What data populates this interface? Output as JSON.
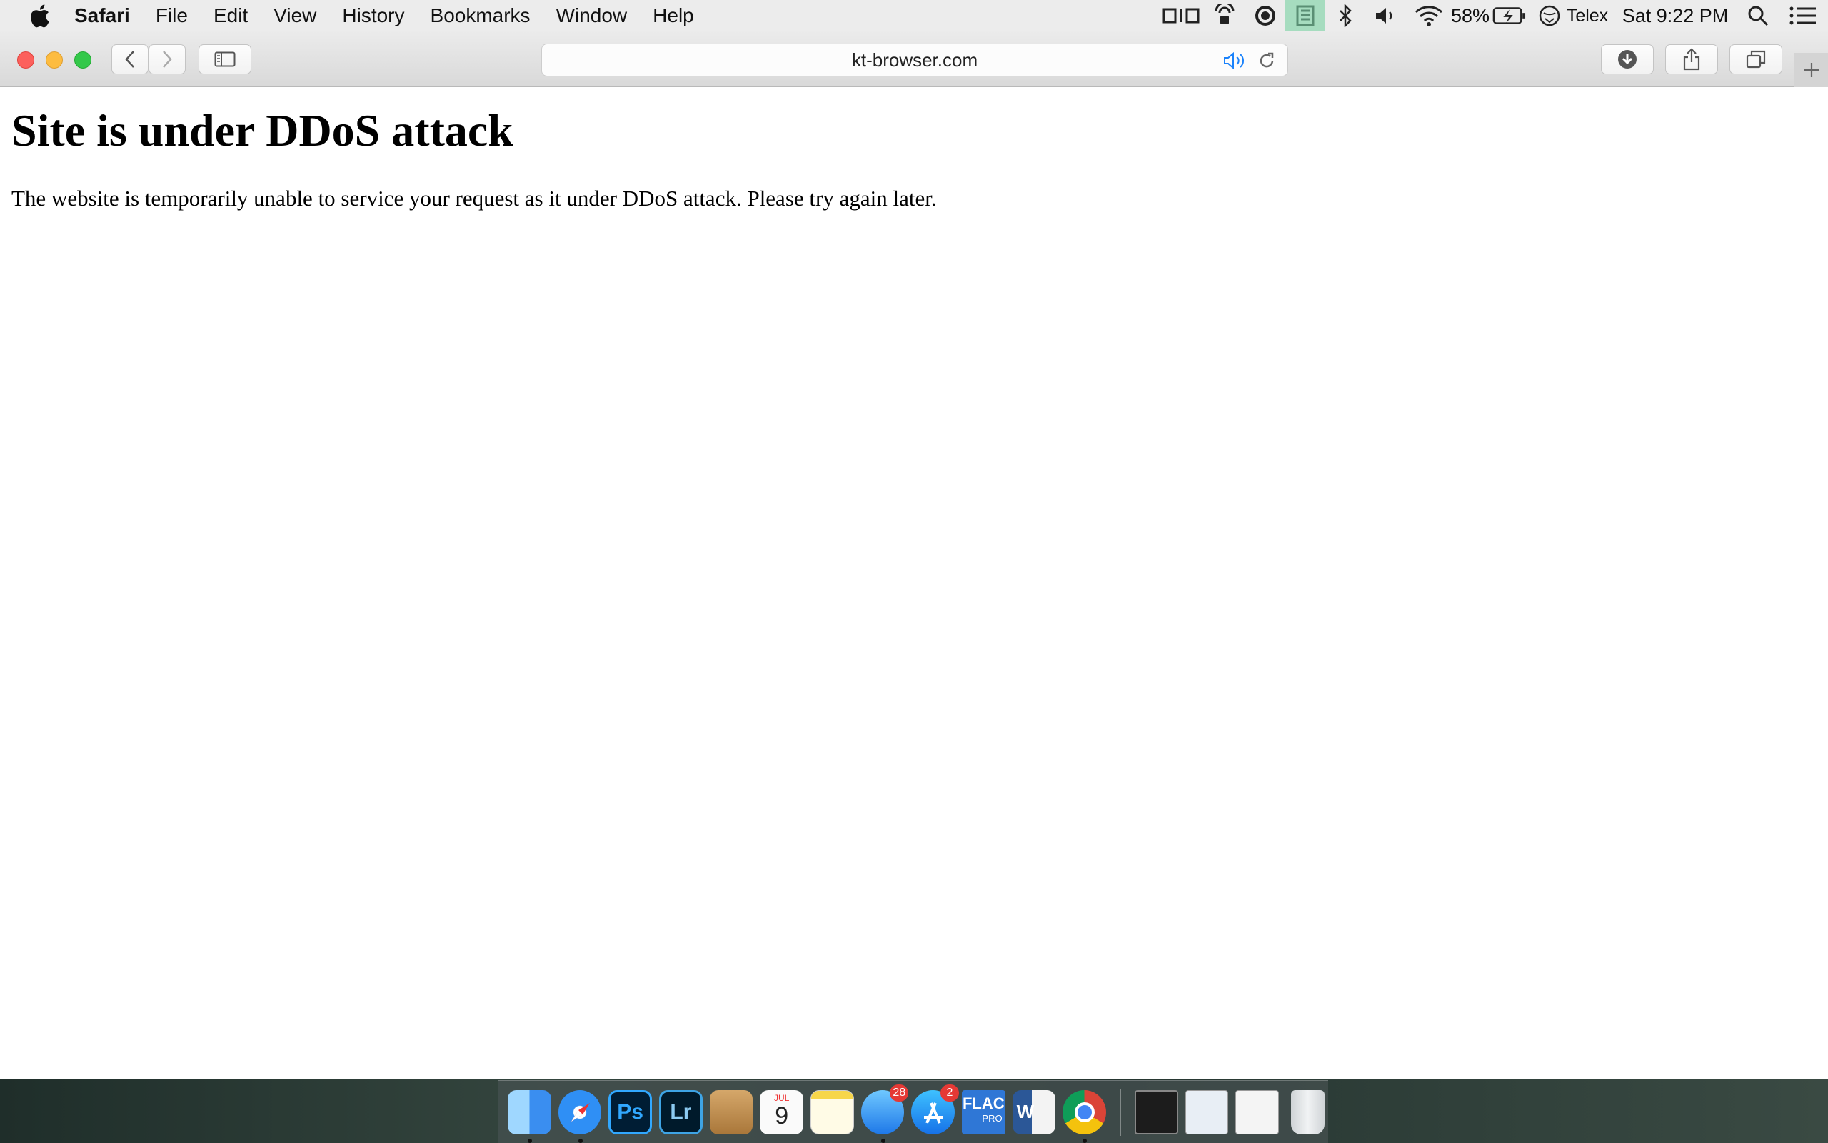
{
  "menubar": {
    "app_name": "Safari",
    "menus": [
      "File",
      "Edit",
      "View",
      "History",
      "Bookmarks",
      "Window",
      "Help"
    ],
    "status": {
      "battery_percent": "58%",
      "input_source": "Telex",
      "clock": "Sat 9:22 PM"
    }
  },
  "toolbar": {
    "address": "kt-browser.com"
  },
  "page": {
    "heading": "Site is under DDoS attack",
    "message": "The website is temporarily unable to service your request as it under DDoS attack. Please try again later."
  },
  "dock": {
    "calendar_month": "JUL",
    "calendar_day": "9",
    "messages_badge": "28",
    "appstore_badge": "2",
    "flac_label": "FLAC",
    "flac_sub": "PRO"
  },
  "colors": {
    "close": "#fc605c",
    "minimize": "#fdbc40",
    "zoom": "#34c84a",
    "accent": "#1a82fb"
  }
}
